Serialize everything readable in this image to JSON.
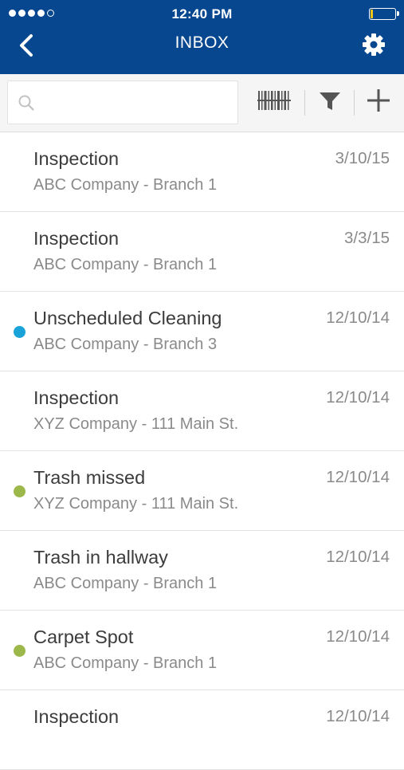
{
  "status_bar": {
    "time": "12:40 PM",
    "signal_dots": 5,
    "signal_filled": 4,
    "battery_level": 0.1,
    "battery_color": "#f0c419"
  },
  "header": {
    "title": "INBOX",
    "background": "#07478f",
    "back_icon": "chevron-left-icon",
    "settings_icon": "gear-icon"
  },
  "toolbar": {
    "search_placeholder": "",
    "search_value": "",
    "barcode_icon": "barcode-icon",
    "filter_icon": "filter-icon",
    "add_icon": "plus-icon"
  },
  "colors": {
    "unread_blue": "#1aa3d9",
    "unread_green": "#9cb84a"
  },
  "messages": [
    {
      "title": "Inspection",
      "subtitle": "ABC Company - Branch 1",
      "date": "3/10/15",
      "indicator": ""
    },
    {
      "title": "Inspection",
      "subtitle": "ABC Company - Branch 1",
      "date": "3/3/15",
      "indicator": ""
    },
    {
      "title": "Unscheduled Cleaning",
      "subtitle": "ABC Company - Branch 3",
      "date": "12/10/14",
      "indicator": "#1aa3d9"
    },
    {
      "title": "Inspection",
      "subtitle": "XYZ Company - 111 Main St.",
      "date": "12/10/14",
      "indicator": ""
    },
    {
      "title": "Trash missed",
      "subtitle": "XYZ Company - 111 Main St.",
      "date": "12/10/14",
      "indicator": "#9cb84a"
    },
    {
      "title": "Trash in hallway",
      "subtitle": "ABC Company - Branch 1",
      "date": "12/10/14",
      "indicator": ""
    },
    {
      "title": "Carpet Spot",
      "subtitle": "ABC Company - Branch 1",
      "date": "12/10/14",
      "indicator": "#9cb84a"
    },
    {
      "title": "Inspection",
      "subtitle": "",
      "date": "12/10/14",
      "indicator": ""
    }
  ]
}
